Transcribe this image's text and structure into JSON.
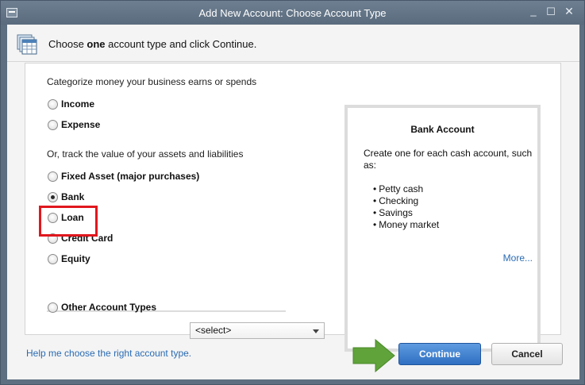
{
  "window": {
    "title": "Add New Account: Choose Account Type",
    "controls": {
      "minimize": "_",
      "maximize": "☐",
      "close": "✕"
    }
  },
  "header": {
    "prefix": "Choose ",
    "emphasis": "one",
    "suffix": " account type and click Continue."
  },
  "sections": {
    "categorize_label": "Categorize money your business earns or spends",
    "track_label": "Or, track the value of your assets and liabilities"
  },
  "account_types": [
    {
      "label": "Income",
      "checked": false
    },
    {
      "label": "Expense",
      "checked": false
    },
    {
      "label": "Fixed Asset (major purchases)",
      "checked": false
    },
    {
      "label": "Bank",
      "checked": true
    },
    {
      "label": "Loan",
      "checked": false
    },
    {
      "label": "Credit Card",
      "checked": false
    },
    {
      "label": "Equity",
      "checked": false
    },
    {
      "label": "Other Account Types",
      "checked": false
    }
  ],
  "other_select": {
    "value": "<select>"
  },
  "info": {
    "title": "Bank Account",
    "description": "Create one for each cash account, such as:",
    "items": [
      "Petty cash",
      "Checking",
      "Savings",
      "Money market"
    ],
    "more_link": "More..."
  },
  "footer": {
    "help_link": "Help me choose the right account type.",
    "continue_label": "Continue",
    "cancel_label": "Cancel"
  },
  "colors": {
    "highlight": "#e0171d",
    "arrow": "#5fa33a",
    "link": "#2a6bb3",
    "primary_button": "#2f6fc2"
  }
}
